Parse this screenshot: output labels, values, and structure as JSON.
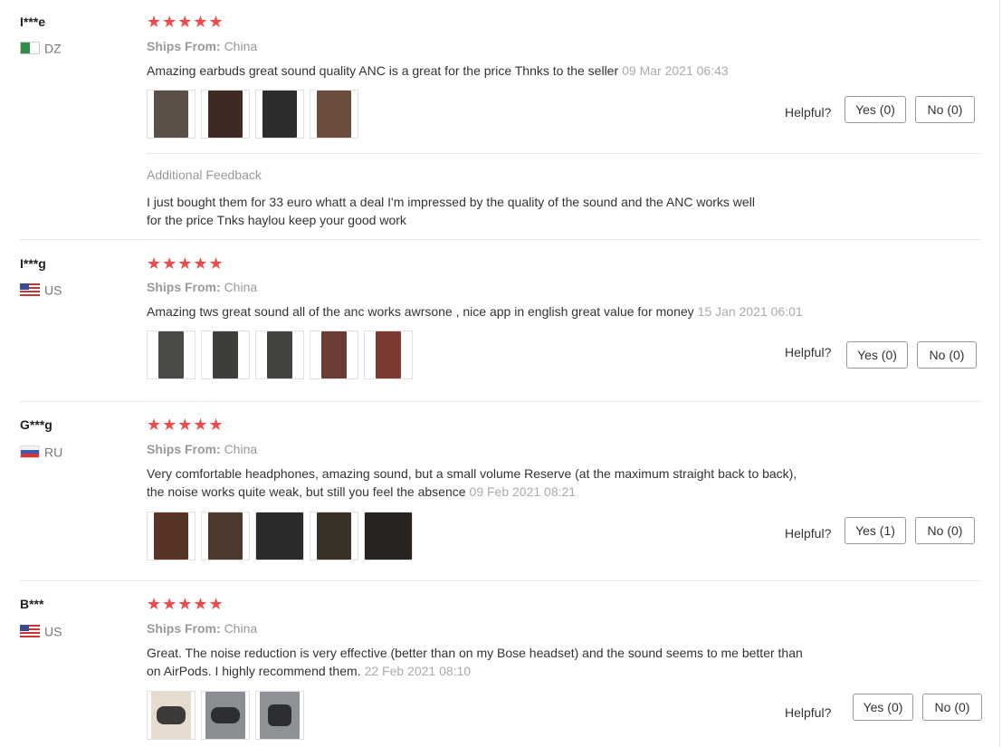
{
  "reviews": [
    {
      "user": "I***e",
      "country": "DZ",
      "stars": "★★★★★",
      "ships_label": "Ships From:",
      "ships_value": "China",
      "text": "Amazing earbuds great sound quality ANC is a great for the price Thnks to the seller",
      "date": "09 Mar 2021 06:43",
      "thumbs": [
        {
          "color": "#5b5047"
        },
        {
          "color": "#3d2a22"
        },
        {
          "color": "#2d2d2d"
        },
        {
          "color": "#6a4d3e"
        }
      ],
      "helpful_label": "Helpful?",
      "yes_label": "Yes (0)",
      "no_label": "No (0)",
      "additional_title": "Additional Feedback",
      "additional_text_1": "I just bought them for 33 euro whatt a deal I'm impressed by the quality of the sound and the ANC works well",
      "additional_text_2": "for the price Tnks haylou keep your good work"
    },
    {
      "user": "I***g",
      "country": "US",
      "stars": "★★★★★",
      "ships_label": "Ships From:",
      "ships_value": "China",
      "text": "Amazing tws great sound all of the anc works awrsone , nice app in english great value for money",
      "date": "15 Jan 2021 06:01",
      "thumbs": [
        {
          "color": "#4c4a47"
        },
        {
          "color": "#3f3d38"
        },
        {
          "color": "#45433f"
        },
        {
          "color": "#6b3d35"
        },
        {
          "color": "#7a3a33"
        }
      ],
      "helpful_label": "Helpful?",
      "yes_label": "Yes (0)",
      "no_label": "No (0)"
    },
    {
      "user": "G***g",
      "country": "RU",
      "stars": "★★★★★",
      "ships_label": "Ships From:",
      "ships_value": "China",
      "text_1": "Very comfortable headphones, amazing sound, but a small volume Reserve (at the maximum straight back to back),",
      "text_2": "the noise works quite weak, but still you feel the absence",
      "date": "09 Feb 2021 08:21",
      "thumbs": [
        {
          "color": "#5a3328"
        },
        {
          "color": "#4d3a2e"
        },
        {
          "color": "#2b2b2b"
        },
        {
          "color": "#3a3128"
        },
        {
          "color": "#2a2420"
        }
      ],
      "helpful_label": "Helpful?",
      "yes_label": "Yes (1)",
      "no_label": "No (0)"
    },
    {
      "user": "B***",
      "country": "US",
      "stars": "★★★★★",
      "ships_label": "Ships From:",
      "ships_value": "China",
      "text_1": "Great. The noise reduction is very effective (better than on my Bose headset) and the sound seems to me better than",
      "text_2": "on AirPods. I highly recommend them.",
      "date": "22 Feb 2021 08:10",
      "thumbs": [
        {
          "color": "#3b3a38"
        },
        {
          "color": "#4a4b4d"
        },
        {
          "color": "#3e4044"
        }
      ],
      "helpful_label": "Helpful?",
      "yes_label": "Yes (0)",
      "no_label": "No (0)"
    }
  ],
  "colors": {
    "star": "#f04a4a",
    "muted": "#999999",
    "text": "#333333"
  }
}
